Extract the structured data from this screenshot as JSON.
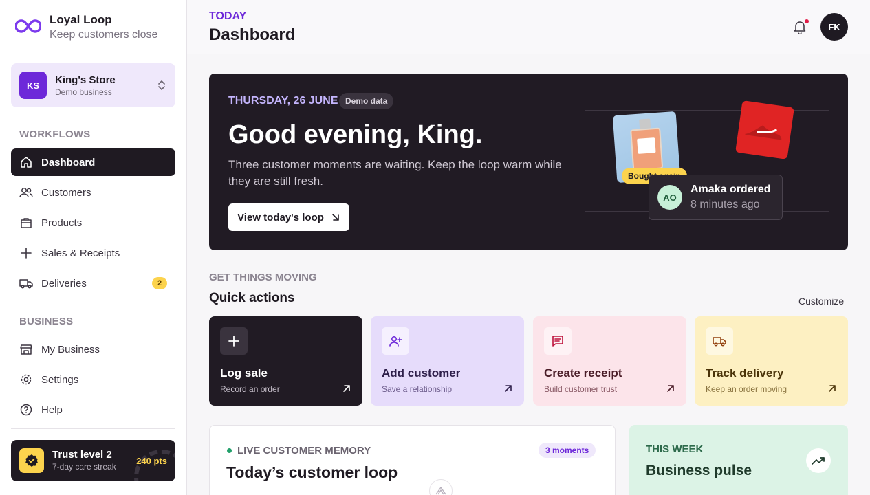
{
  "brand": {
    "name": "Loyal Loop",
    "tagline": "Keep customers close",
    "accent": "#6d28d9"
  },
  "store": {
    "initials": "KS",
    "name": "King's Store",
    "subtitle": "Demo business"
  },
  "sidebar": {
    "workflows_heading": "WORKFLOWS",
    "workflows": [
      {
        "label": "Dashboard",
        "icon": "home-icon",
        "active": true
      },
      {
        "label": "Customers",
        "icon": "users-icon"
      },
      {
        "label": "Products",
        "icon": "bag-icon"
      },
      {
        "label": "Sales & Receipts",
        "icon": "plus-icon"
      },
      {
        "label": "Deliveries",
        "icon": "truck-icon",
        "badge": "2"
      }
    ],
    "business_heading": "BUSINESS",
    "business": [
      {
        "label": "My Business",
        "icon": "store-icon"
      },
      {
        "label": "Settings",
        "icon": "gear-icon"
      },
      {
        "label": "Help",
        "icon": "help-icon"
      }
    ],
    "trust": {
      "title": "Trust level 2",
      "subtitle": "7-day care streak",
      "points": "240 pts"
    }
  },
  "header": {
    "eyebrow": "TODAY",
    "title": "Dashboard",
    "user_initials": "FK"
  },
  "hero": {
    "date": "THURSDAY, 26 JUNE",
    "chip": "Demo data",
    "greeting": "Good evening, King.",
    "subtitle": "Three customer moments are waiting. Keep the loop warm while they are still fresh.",
    "button": "View today's loop",
    "tag": "Bought again",
    "order": {
      "initials": "AO",
      "title": "Amaka ordered",
      "time": "8 minutes ago"
    }
  },
  "quick_actions": {
    "eyebrow": "GET THINGS MOVING",
    "title": "Quick actions",
    "customize": "Customize",
    "items": [
      {
        "label": "Log sale",
        "subtitle": "Record an order",
        "icon": "plus-icon"
      },
      {
        "label": "Add customer",
        "subtitle": "Save a relationship",
        "icon": "user-plus-icon"
      },
      {
        "label": "Create receipt",
        "subtitle": "Build customer trust",
        "icon": "receipt-icon"
      },
      {
        "label": "Track delivery",
        "subtitle": "Keep an order moving",
        "icon": "truck-icon"
      }
    ]
  },
  "memory": {
    "eyebrow": "LIVE CUSTOMER MEMORY",
    "title": "Today’s customer loop",
    "badge": "3 moments"
  },
  "pulse": {
    "eyebrow": "THIS WEEK",
    "title": "Business pulse"
  }
}
